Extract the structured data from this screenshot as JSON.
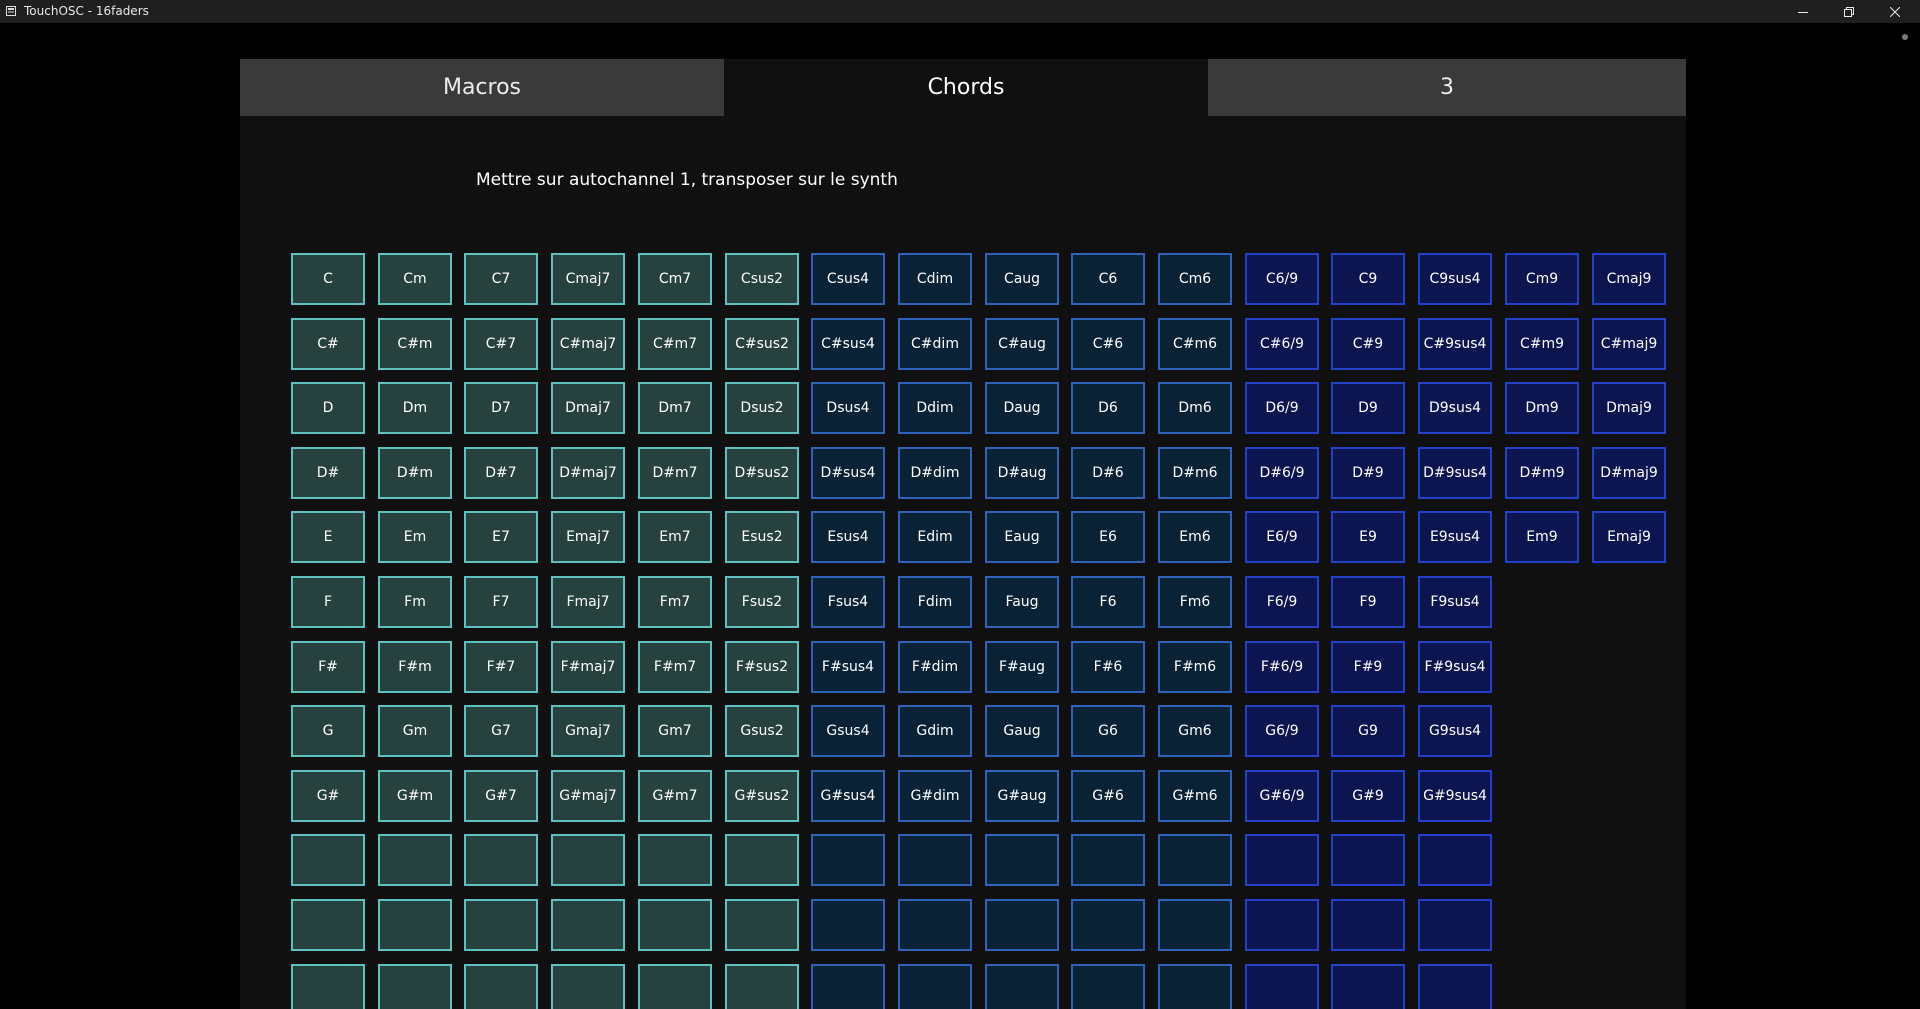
{
  "window": {
    "title": "TouchOSC - 16faders",
    "icon": "app-icon",
    "controls": [
      "minimize-icon",
      "restore-icon",
      "close-icon"
    ]
  },
  "tabs": [
    {
      "label": "Macros",
      "active": false
    },
    {
      "label": "Chords",
      "active": true
    },
    {
      "label": "3",
      "active": false
    }
  ],
  "instruction": "Mettre sur autochannel 1, transposer sur le synth",
  "colors": {
    "background": "#000000",
    "panel": "#101010",
    "tab_inactive": "#3a3a3a",
    "group_teal_fill": "#27413f",
    "group_teal_border": "#5fc0c0",
    "group_blue_fill": "#0a2236",
    "group_blue_border": "#2f62b8",
    "group_indigo_fill": "#0d1550",
    "group_indigo_border": "#2440c8"
  },
  "chord_grid": {
    "rows": [
      [
        "C",
        "Cm",
        "C7",
        "Cmaj7",
        "Cm7",
        "Csus2",
        "Csus4",
        "Cdim",
        "Caug",
        "C6",
        "Cm6",
        "C6/9",
        "C9",
        "C9sus4",
        "Cm9",
        "Cmaj9"
      ],
      [
        "C#",
        "C#m",
        "C#7",
        "C#maj7",
        "C#m7",
        "C#sus2",
        "C#sus4",
        "C#dim",
        "C#aug",
        "C#6",
        "C#m6",
        "C#6/9",
        "C#9",
        "C#9sus4",
        "C#m9",
        "C#maj9"
      ],
      [
        "D",
        "Dm",
        "D7",
        "Dmaj7",
        "Dm7",
        "Dsus2",
        "Dsus4",
        "Ddim",
        "Daug",
        "D6",
        "Dm6",
        "D6/9",
        "D9",
        "D9sus4",
        "Dm9",
        "Dmaj9"
      ],
      [
        "D#",
        "D#m",
        "D#7",
        "D#maj7",
        "D#m7",
        "D#sus2",
        "D#sus4",
        "D#dim",
        "D#aug",
        "D#6",
        "D#m6",
        "D#6/9",
        "D#9",
        "D#9sus4",
        "D#m9",
        "D#maj9"
      ],
      [
        "E",
        "Em",
        "E7",
        "Emaj7",
        "Em7",
        "Esus2",
        "Esus4",
        "Edim",
        "Eaug",
        "E6",
        "Em6",
        "E6/9",
        "E9",
        "E9sus4",
        "Em9",
        "Emaj9"
      ],
      [
        "F",
        "Fm",
        "F7",
        "Fmaj7",
        "Fm7",
        "Fsus2",
        "Fsus4",
        "Fdim",
        "Faug",
        "F6",
        "Fm6",
        "F6/9",
        "F9",
        "F9sus4"
      ],
      [
        "F#",
        "F#m",
        "F#7",
        "F#maj7",
        "F#m7",
        "F#sus2",
        "F#sus4",
        "F#dim",
        "F#aug",
        "F#6",
        "F#m6",
        "F#6/9",
        "F#9",
        "F#9sus4"
      ],
      [
        "G",
        "Gm",
        "G7",
        "Gmaj7",
        "Gm7",
        "Gsus2",
        "Gsus4",
        "Gdim",
        "Gaug",
        "G6",
        "Gm6",
        "G6/9",
        "G9",
        "G9sus4"
      ],
      [
        "G#",
        "G#m",
        "G#7",
        "G#maj7",
        "G#m7",
        "G#sus2",
        "G#sus4",
        "G#dim",
        "G#aug",
        "G#6",
        "G#m6",
        "G#6/9",
        "G#9",
        "G#9sus4"
      ],
      [
        "",
        "",
        "",
        "",
        "",
        "",
        "",
        "",
        "",
        "",
        "",
        "",
        "",
        ""
      ],
      [
        "",
        "",
        "",
        "",
        "",
        "",
        "",
        "",
        "",
        "",
        "",
        "",
        "",
        ""
      ],
      [
        "",
        "",
        "",
        "",
        "",
        "",
        "",
        "",
        "",
        "",
        "",
        "",
        "",
        ""
      ]
    ]
  }
}
